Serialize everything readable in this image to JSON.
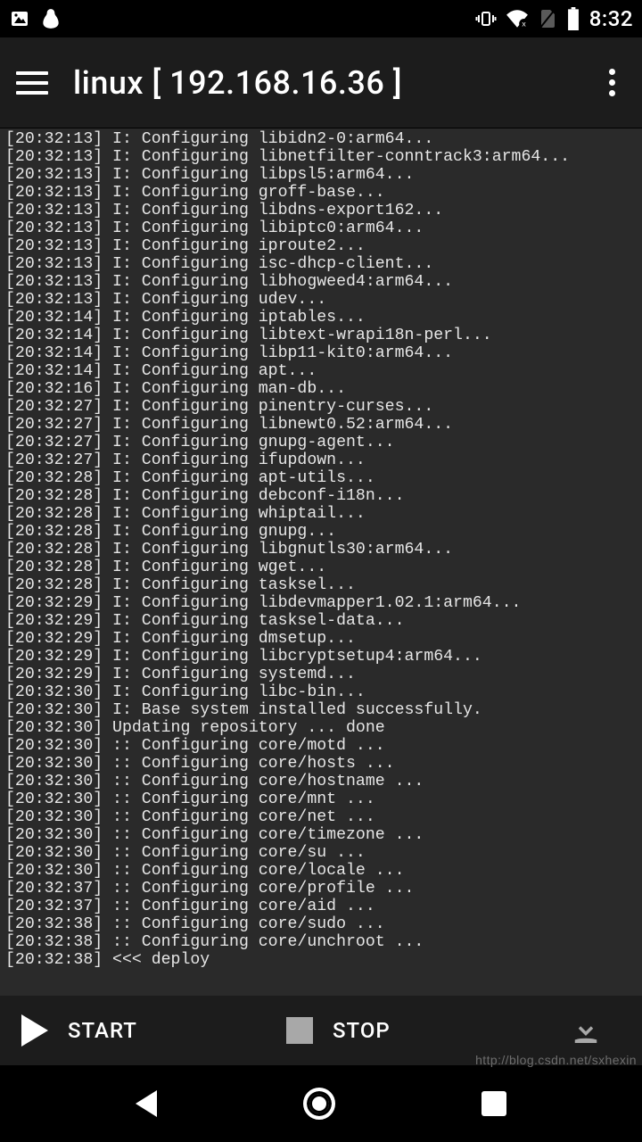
{
  "status": {
    "clock": "8:32"
  },
  "appbar": {
    "title": "linux  [ 192.168.16.36 ]"
  },
  "terminal": {
    "lines": [
      "[20:32:13] I: Configuring libidn2-0:arm64...",
      "[20:32:13] I: Configuring libnetfilter-conntrack3:arm64...",
      "[20:32:13] I: Configuring libpsl5:arm64...",
      "[20:32:13] I: Configuring groff-base...",
      "[20:32:13] I: Configuring libdns-export162...",
      "[20:32:13] I: Configuring libiptc0:arm64...",
      "[20:32:13] I: Configuring iproute2...",
      "[20:32:13] I: Configuring isc-dhcp-client...",
      "[20:32:13] I: Configuring libhogweed4:arm64...",
      "[20:32:13] I: Configuring udev...",
      "[20:32:14] I: Configuring iptables...",
      "[20:32:14] I: Configuring libtext-wrapi18n-perl...",
      "[20:32:14] I: Configuring libp11-kit0:arm64...",
      "[20:32:14] I: Configuring apt...",
      "[20:32:16] I: Configuring man-db...",
      "[20:32:27] I: Configuring pinentry-curses...",
      "[20:32:27] I: Configuring libnewt0.52:arm64...",
      "[20:32:27] I: Configuring gnupg-agent...",
      "[20:32:27] I: Configuring ifupdown...",
      "[20:32:28] I: Configuring apt-utils...",
      "[20:32:28] I: Configuring debconf-i18n...",
      "[20:32:28] I: Configuring whiptail...",
      "[20:32:28] I: Configuring gnupg...",
      "[20:32:28] I: Configuring libgnutls30:arm64...",
      "[20:32:28] I: Configuring wget...",
      "[20:32:28] I: Configuring tasksel...",
      "[20:32:29] I: Configuring libdevmapper1.02.1:arm64...",
      "[20:32:29] I: Configuring tasksel-data...",
      "[20:32:29] I: Configuring dmsetup...",
      "[20:32:29] I: Configuring libcryptsetup4:arm64...",
      "[20:32:29] I: Configuring systemd...",
      "[20:32:30] I: Configuring libc-bin...",
      "[20:32:30] I: Base system installed successfully.",
      "[20:32:30] Updating repository ... done",
      "[20:32:30] :: Configuring core/motd ...",
      "[20:32:30] :: Configuring core/hosts ...",
      "[20:32:30] :: Configuring core/hostname ...",
      "[20:32:30] :: Configuring core/mnt ...",
      "[20:32:30] :: Configuring core/net ...",
      "[20:32:30] :: Configuring core/timezone ...",
      "[20:32:30] :: Configuring core/su ...",
      "[20:32:30] :: Configuring core/locale ...",
      "[20:32:37] :: Configuring core/profile ...",
      "[20:32:37] :: Configuring core/aid ...",
      "[20:32:38] :: Configuring core/sudo ...",
      "[20:32:38] :: Configuring core/unchroot ...",
      "[20:32:38] <<< deploy"
    ]
  },
  "actions": {
    "start_label": "START",
    "stop_label": "STOP"
  },
  "watermark": "http://blog.csdn.net/sxhexin"
}
